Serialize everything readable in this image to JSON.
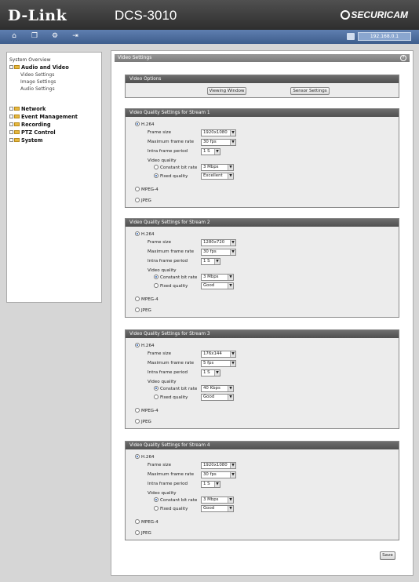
{
  "header": {
    "brand": "D-Link",
    "model": "DCS-3010",
    "securicam": "SECURICAM"
  },
  "toolbar": {
    "ip_address": "192.168.0.1"
  },
  "sidebar": {
    "overview": "System Overview",
    "audio_video": "Audio and Video",
    "video_settings": "Video Settings",
    "image_settings": "Image Settings",
    "audio_settings": "Audio Settings",
    "network": "Network",
    "event_management": "Event Management",
    "recording": "Recording",
    "ptz_control": "PTZ Control",
    "system": "System"
  },
  "main": {
    "title": "Video Settings",
    "help": "?",
    "video_options": {
      "header": "Video Options",
      "viewing_window": "Viewing Window",
      "sensor_settings": "Sensor Settings"
    }
  },
  "labels": {
    "h264": "H.264",
    "mpeg4": "MPEG-4",
    "jpeg": "JPEG",
    "frame_size": "Frame size",
    "max_frame_rate": "Maximum frame rate",
    "intra_frame_period": "Intra frame period",
    "video_quality": "Video quality",
    "constant_bit_rate": "Constant bit rate",
    "fixed_quality": "Fixed quality"
  },
  "streams": [
    {
      "header": "Video Quality Settings for Stream 1",
      "frame_size": "1920x1080",
      "max_frame_rate": "30 fps",
      "intra_frame_period": "1 S",
      "bit_rate": "3 Mbps",
      "fixed_quality": "Excellent"
    },
    {
      "header": "Video Quality Settings for Stream 2",
      "frame_size": "1280x720",
      "max_frame_rate": "30 fps",
      "intra_frame_period": "1 S",
      "bit_rate": "3 Mbps",
      "fixed_quality": "Good"
    },
    {
      "header": "Video Quality Settings for Stream 3",
      "frame_size": "176x144",
      "max_frame_rate": "5 fps",
      "intra_frame_period": "1 S",
      "bit_rate": "40 Kbps",
      "fixed_quality": "Good"
    },
    {
      "header": "Video Quality Settings for Stream 4",
      "frame_size": "1920x1080",
      "max_frame_rate": "30 fps",
      "intra_frame_period": "1 S",
      "bit_rate": "3 Mbps",
      "fixed_quality": "Good"
    }
  ],
  "save_label": "Save"
}
